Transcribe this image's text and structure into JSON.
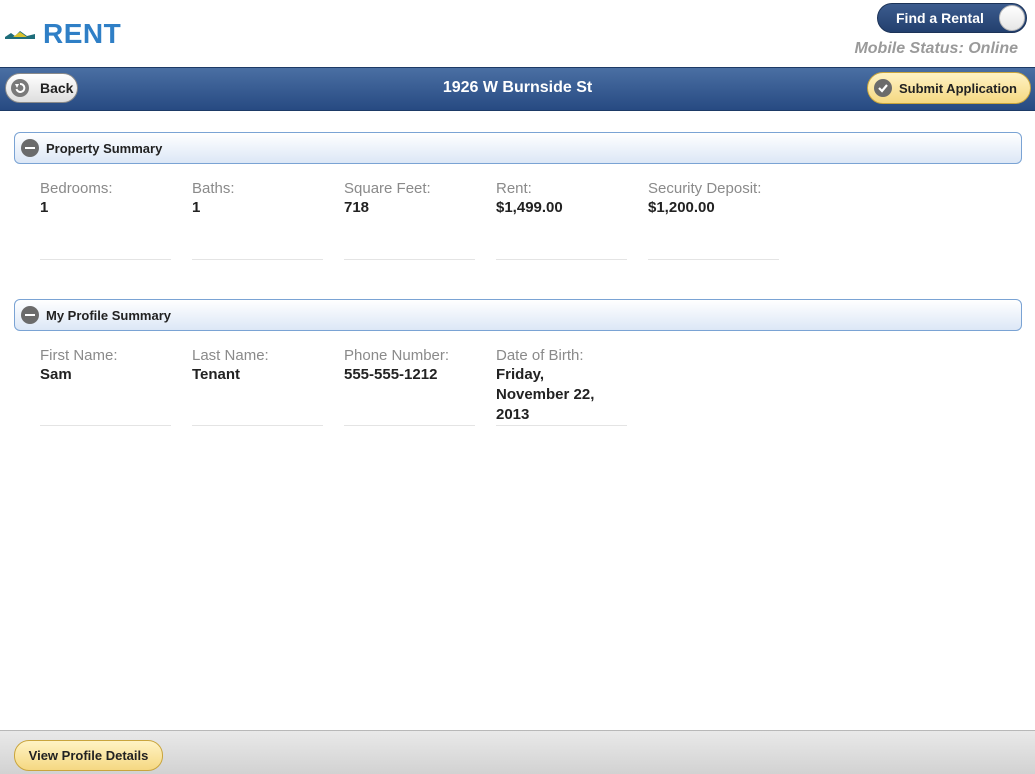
{
  "header": {
    "logo_text": "Rent",
    "find_rental_label": "Find a Rental",
    "mobile_status": "Mobile Status: Online"
  },
  "nav": {
    "back_label": "Back",
    "title": "1926 W Burnside St",
    "submit_label": "Submit Application"
  },
  "property_summary": {
    "title": "Property Summary",
    "fields": [
      {
        "label": "Bedrooms:",
        "value": "1"
      },
      {
        "label": "Baths:",
        "value": "1"
      },
      {
        "label": "Square Feet:",
        "value": "718"
      },
      {
        "label": "Rent:",
        "value": "$1,499.00"
      },
      {
        "label": "Security Deposit:",
        "value": "$1,200.00"
      }
    ]
  },
  "profile_summary": {
    "title": "My Profile Summary",
    "fields": [
      {
        "label": "First Name:",
        "value": "Sam"
      },
      {
        "label": "Last Name:",
        "value": "Tenant"
      },
      {
        "label": "Phone Number:",
        "value": "555-555-1212"
      },
      {
        "label": "Date of Birth:",
        "value": "Friday, November 22, 2013"
      }
    ]
  },
  "footer": {
    "view_profile_label": "View Profile Details"
  },
  "colors": {
    "brand_blue": "#2f7fc6",
    "nav_blue": "#274a82",
    "button_yellow": "#f5d882"
  },
  "icons": {
    "back": "back-arrow-icon",
    "submit": "checkmark-icon",
    "collapse": "minus-icon"
  }
}
